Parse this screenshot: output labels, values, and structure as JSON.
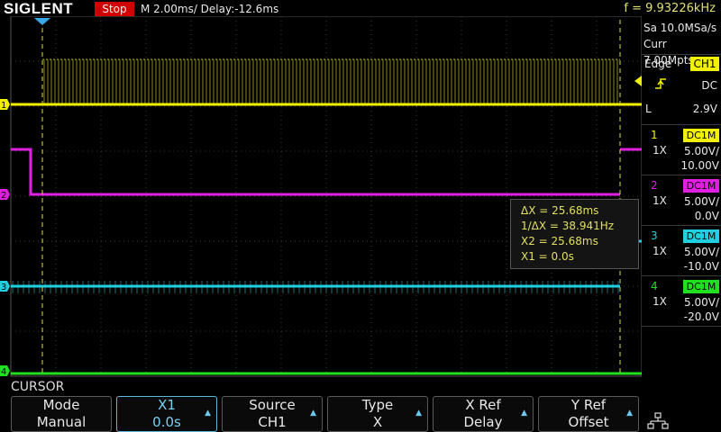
{
  "topbar": {
    "brand": "SIGLENT",
    "run_state": "Stop",
    "timebase": "M 2.00ms/ Delay:-12.6ms",
    "frequency": "f = 9.93226kHz"
  },
  "acquisition": {
    "sample_rate": "Sa 10.0MSa/s",
    "memory": "Curr 7.00Mpts"
  },
  "trigger": {
    "type": "Edge",
    "source": "CH1",
    "slope_icon": "rising-edge-icon",
    "coupling": "DC",
    "level_label": "L",
    "level": "2.9V"
  },
  "channels": [
    {
      "num": "1",
      "coupling": "DC1M",
      "probe": "1X",
      "scale": "5.00V/",
      "offset": "10.00V",
      "color": "#f0f000"
    },
    {
      "num": "2",
      "coupling": "DC1M",
      "probe": "1X",
      "scale": "5.00V/",
      "offset": "0.0V",
      "color": "#e020e0"
    },
    {
      "num": "3",
      "coupling": "DC1M",
      "probe": "1X",
      "scale": "5.00V/",
      "offset": "-10.0V",
      "color": "#20d0e0"
    },
    {
      "num": "4",
      "coupling": "DC1M",
      "probe": "1X",
      "scale": "5.00V/",
      "offset": "-20.0V",
      "color": "#20e020"
    }
  ],
  "cursor_readout": {
    "delta_x": "ΔX = 25.68ms",
    "inv_delta_x": "1/ΔX = 38.941Hz",
    "x2": "X2 = 25.68ms",
    "x1": "X1 = 0.0s"
  },
  "menu": {
    "title": "CURSOR",
    "softkeys": [
      {
        "label": "Mode",
        "value": "Manual",
        "active": false,
        "arrow": false
      },
      {
        "label": "X1",
        "value": "0.0s",
        "active": true,
        "arrow": true
      },
      {
        "label": "Source",
        "value": "CH1",
        "active": false,
        "arrow": true
      },
      {
        "label": "Type",
        "value": "X",
        "active": false,
        "arrow": true
      },
      {
        "label": "X Ref",
        "value": "Delay",
        "active": false,
        "arrow": true
      },
      {
        "label": "Y Ref",
        "value": "Offset",
        "active": false,
        "arrow": true
      }
    ]
  },
  "markers": {
    "ch1": "1",
    "ch2": "2",
    "ch3": "3",
    "ch4": "4"
  }
}
